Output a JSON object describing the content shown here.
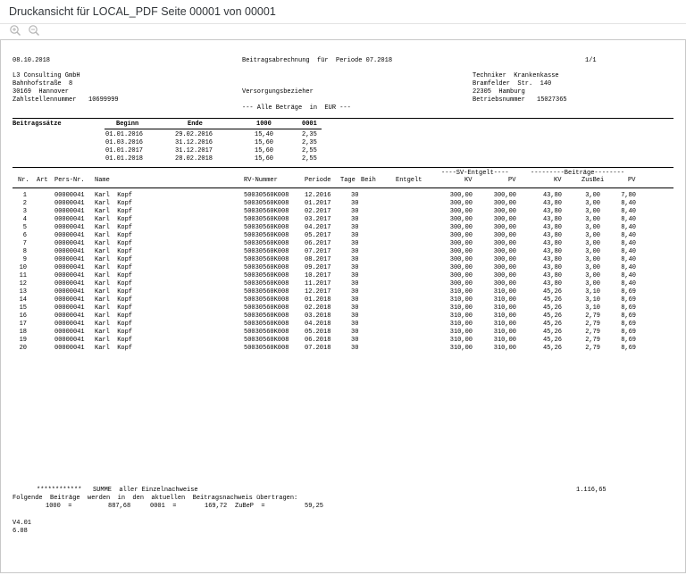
{
  "window": {
    "title": "Druckansicht für LOCAL_PDF Seite 00001 von 00001"
  },
  "toolbar": {
    "zoom_in_icon": "zoom-in-icon",
    "zoom_out_icon": "zoom-out-icon"
  },
  "report": {
    "date": "08.10.2018",
    "heading": "Beitragsabrechnung  für  Periode 07.2018",
    "page": "1/1",
    "sender": {
      "name": "L3 Consulting GmbH",
      "street": "Bahnhofstraße  8",
      "city": "30169  Hannover",
      "account_label": "Zahlstellennummer",
      "account_number": "10699999"
    },
    "recipient": {
      "name": "Techniker  Krankenkasse",
      "street": "Bramfelder  Str.  140",
      "city": "22305  Hamburg",
      "company_label": "Betriebsnummer",
      "company_number": "15027365"
    },
    "group": "Versorgungsbezieher",
    "currency_note": "--- Alle Beträge  in  EUR ---",
    "rates": {
      "label": "Beitragssätze",
      "headers": [
        "Beginn",
        "Ende",
        "1000",
        "0001"
      ],
      "rows": [
        [
          "01.01.2016",
          "29.02.2016",
          "15,40",
          "2,35"
        ],
        [
          "01.03.2016",
          "31.12.2016",
          "15,60",
          "2,35"
        ],
        [
          "01.01.2017",
          "31.12.2017",
          "15,60",
          "2,55"
        ],
        [
          "01.01.2018",
          "28.02.2018",
          "15,60",
          "2,55"
        ]
      ]
    },
    "table": {
      "group_sv": "----SV-Entgelt----",
      "group_beitraege": "---------Beiträge--------",
      "headers": {
        "nr": "Nr.",
        "art": "Art",
        "pers": "Pers-Nr.",
        "name": "Name",
        "rv": "RV-Nummer",
        "periode": "Periode",
        "tage": "Tage",
        "beih": "Beih",
        "entgelt": "Entgelt",
        "kv1": "KV",
        "pv1": "PV",
        "kv2": "KV",
        "zusbei": "ZusBei",
        "pv2": "PV"
      },
      "rows": [
        [
          "1",
          "00000041",
          "Karl  Kopf",
          "50030560K008",
          "12.2016",
          "30",
          "300,00",
          "300,00",
          "43,80",
          "3,00",
          "7,80"
        ],
        [
          "2",
          "00000041",
          "Karl  Kopf",
          "50030560K008",
          "01.2017",
          "30",
          "300,00",
          "300,00",
          "43,80",
          "3,00",
          "8,40"
        ],
        [
          "3",
          "00000041",
          "Karl  Kopf",
          "50030560K008",
          "02.2017",
          "30",
          "300,00",
          "300,00",
          "43,80",
          "3,00",
          "8,40"
        ],
        [
          "4",
          "00000041",
          "Karl  Kopf",
          "50030560K008",
          "03.2017",
          "30",
          "300,00",
          "300,00",
          "43,80",
          "3,00",
          "8,40"
        ],
        [
          "5",
          "00000041",
          "Karl  Kopf",
          "50030560K008",
          "04.2017",
          "30",
          "300,00",
          "300,00",
          "43,80",
          "3,00",
          "8,40"
        ],
        [
          "6",
          "00000041",
          "Karl  Kopf",
          "50030560K008",
          "05.2017",
          "30",
          "300,00",
          "300,00",
          "43,80",
          "3,00",
          "8,40"
        ],
        [
          "7",
          "00000041",
          "Karl  Kopf",
          "50030560K008",
          "06.2017",
          "30",
          "300,00",
          "300,00",
          "43,80",
          "3,00",
          "8,40"
        ],
        [
          "8",
          "00000041",
          "Karl  Kopf",
          "50030560K008",
          "07.2017",
          "30",
          "300,00",
          "300,00",
          "43,80",
          "3,00",
          "8,40"
        ],
        [
          "9",
          "00000041",
          "Karl  Kopf",
          "50030560K008",
          "08.2017",
          "30",
          "300,00",
          "300,00",
          "43,80",
          "3,00",
          "8,40"
        ],
        [
          "10",
          "00000041",
          "Karl  Kopf",
          "50030560K008",
          "09.2017",
          "30",
          "300,00",
          "300,00",
          "43,80",
          "3,00",
          "8,40"
        ],
        [
          "11",
          "00000041",
          "Karl  Kopf",
          "50030560K008",
          "10.2017",
          "30",
          "300,00",
          "300,00",
          "43,80",
          "3,00",
          "8,40"
        ],
        [
          "12",
          "00000041",
          "Karl  Kopf",
          "50030560K008",
          "11.2017",
          "30",
          "300,00",
          "300,00",
          "43,80",
          "3,00",
          "8,40"
        ],
        [
          "13",
          "00000041",
          "Karl  Kopf",
          "50030560K008",
          "12.2017",
          "30",
          "310,00",
          "310,00",
          "45,26",
          "3,10",
          "8,69"
        ],
        [
          "14",
          "00000041",
          "Karl  Kopf",
          "50030560K008",
          "01.2018",
          "30",
          "310,00",
          "310,00",
          "45,26",
          "3,10",
          "8,69"
        ],
        [
          "15",
          "00000041",
          "Karl  Kopf",
          "50030560K008",
          "02.2018",
          "30",
          "310,00",
          "310,00",
          "45,26",
          "3,10",
          "8,69"
        ],
        [
          "16",
          "00000041",
          "Karl  Kopf",
          "50030560K008",
          "03.2018",
          "30",
          "310,00",
          "310,00",
          "45,26",
          "2,79",
          "8,69"
        ],
        [
          "17",
          "00000041",
          "Karl  Kopf",
          "50030560K008",
          "04.2018",
          "30",
          "310,00",
          "310,00",
          "45,26",
          "2,79",
          "8,69"
        ],
        [
          "18",
          "00000041",
          "Karl  Kopf",
          "50030560K008",
          "05.2018",
          "30",
          "310,00",
          "310,00",
          "45,26",
          "2,79",
          "8,69"
        ],
        [
          "19",
          "00000041",
          "Karl  Kopf",
          "50030560K008",
          "06.2018",
          "30",
          "310,00",
          "310,00",
          "45,26",
          "2,79",
          "8,69"
        ],
        [
          "20",
          "00000041",
          "Karl  Kopf",
          "50030560K008",
          "07.2018",
          "30",
          "310,00",
          "310,00",
          "45,26",
          "2,79",
          "8,69"
        ]
      ]
    },
    "summary": {
      "stars": "************",
      "label": "SUMME  aller Einzelnachweise",
      "total": "1.116,65",
      "transfer_note": "Folgende  Beiträge  werden  in  den  aktuellen  Beitragsnachweis übertragen:",
      "line_1000_label": "1000  =",
      "line_1000_value": "887,68",
      "line_0001_label": "0001  =",
      "line_0001_value": "169,72",
      "line_zubep_label": "ZuBeP  =",
      "line_zubep_value": "59,25"
    },
    "footer": {
      "version": "V4.01",
      "release": "6.08"
    }
  }
}
